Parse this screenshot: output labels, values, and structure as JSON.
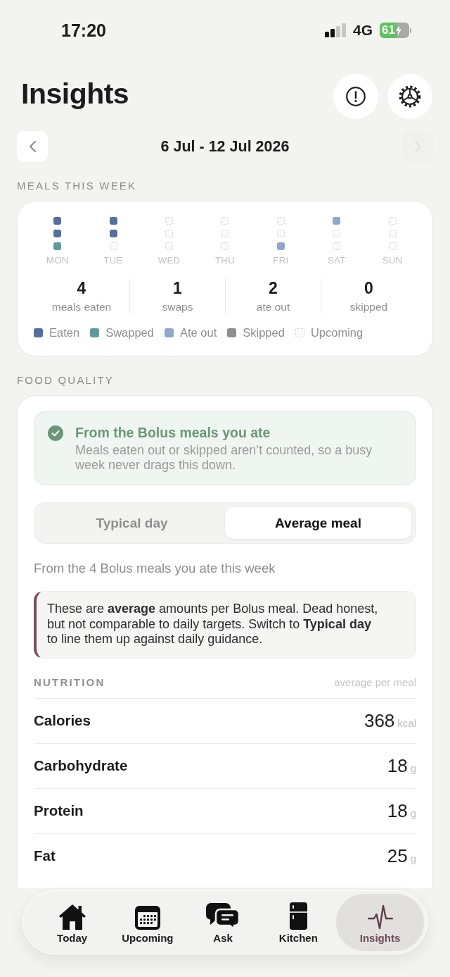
{
  "status_bar": {
    "time": "17:20",
    "network": "4G",
    "battery": "61"
  },
  "header": {
    "title": "Insights"
  },
  "date_nav": {
    "range": "6 Jul - 12 Jul 2026",
    "prev": {
      "disabled": false
    },
    "next": {
      "disabled": true
    }
  },
  "meals": {
    "heading": "MEALS THIS WEEK",
    "days": [
      {
        "label": "MON",
        "slots": [
          {
            "kind": "eaten"
          },
          {
            "kind": "eaten"
          },
          {
            "kind": "swapped"
          }
        ]
      },
      {
        "label": "TUE",
        "slots": [
          {
            "kind": "eaten"
          },
          {
            "kind": "eaten"
          },
          {
            "kind": "upcoming"
          }
        ]
      },
      {
        "label": "WED",
        "slots": [
          {
            "kind": "upcoming"
          },
          {
            "kind": "upcoming"
          },
          {
            "kind": "upcoming"
          }
        ]
      },
      {
        "label": "THU",
        "slots": [
          {
            "kind": "upcoming"
          },
          {
            "kind": "upcoming"
          },
          {
            "kind": "upcoming"
          }
        ]
      },
      {
        "label": "FRI",
        "slots": [
          {
            "kind": "upcoming"
          },
          {
            "kind": "upcoming"
          },
          {
            "kind": "ate_out"
          }
        ]
      },
      {
        "label": "SAT",
        "slots": [
          {
            "kind": "ate_out"
          },
          {
            "kind": "upcoming"
          },
          {
            "kind": "upcoming"
          }
        ]
      },
      {
        "label": "SUN",
        "slots": [
          {
            "kind": "upcoming"
          },
          {
            "kind": "upcoming"
          },
          {
            "kind": "upcoming"
          }
        ]
      }
    ],
    "stats": [
      {
        "value": "4",
        "label": "meals eaten"
      },
      {
        "value": "1",
        "label": "swaps"
      },
      {
        "value": "2",
        "label": "ate out"
      },
      {
        "value": "0",
        "label": "skipped"
      }
    ],
    "legend": [
      {
        "label": "Eaten",
        "kind": "eaten",
        "color": "#52709f"
      },
      {
        "label": "Swapped",
        "kind": "swapped",
        "color": "#5f9b9c"
      },
      {
        "label": "Ate out",
        "kind": "ate_out",
        "color": "#90a7cb"
      },
      {
        "label": "Skipped",
        "kind": "skipped",
        "color": "#8e8e92"
      },
      {
        "label": "Upcoming",
        "kind": "upcoming",
        "color": "#d6d6d6"
      }
    ]
  },
  "food_quality": {
    "heading": "FOOD QUALITY",
    "banner": {
      "title": "From the Bolus meals you ate",
      "text": "Meals eaten out or skipped aren’t counted, so a busy week never drags this down."
    },
    "tabs": [
      {
        "label": "Typical day",
        "selected": false
      },
      {
        "label": "Average meal",
        "selected": true
      }
    ],
    "summary": "From the 4 Bolus meals you ate this week",
    "note": "These are **average** amounts per Bolus meal. Dead honest, but not comparable to daily targets. Switch to **Typical day** to line them up against daily guidance.",
    "nutrition": {
      "heading": "NUTRITION",
      "caption": "average per meal",
      "rows": [
        {
          "name": "Calories",
          "value": "368",
          "unit": "kcal"
        },
        {
          "name": "Carbohydrate",
          "value": "18",
          "unit": "g"
        },
        {
          "name": "Protein",
          "value": "18",
          "unit": "g"
        },
        {
          "name": "Fat",
          "value": "25",
          "unit": "g"
        }
      ]
    }
  },
  "nav": [
    {
      "label": "Today",
      "selected": false
    },
    {
      "label": "Upcoming",
      "selected": false
    },
    {
      "label": "Ask",
      "selected": false
    },
    {
      "label": "Kitchen",
      "selected": false
    },
    {
      "label": "Insights",
      "selected": true
    }
  ]
}
